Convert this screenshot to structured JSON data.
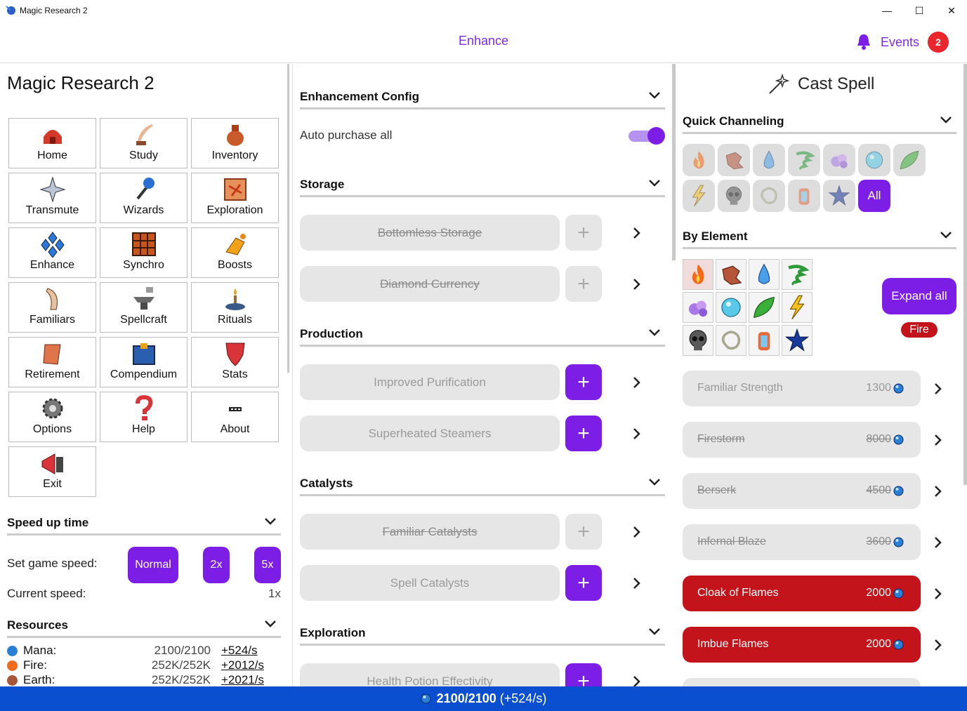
{
  "window": {
    "title": "Magic Research 2",
    "minimize": "—",
    "maximize": "☐",
    "close": "✕"
  },
  "topbar": {
    "page_title": "Enhance",
    "events_label": "Events",
    "events_count": "2"
  },
  "left": {
    "app_title": "Magic Research 2",
    "nav": [
      {
        "label": "Home",
        "icon": "home-icon"
      },
      {
        "label": "Study",
        "icon": "quill-icon"
      },
      {
        "label": "Inventory",
        "icon": "bag-icon"
      },
      {
        "label": "Transmute",
        "icon": "star-icon"
      },
      {
        "label": "Wizards",
        "icon": "wand-icon"
      },
      {
        "label": "Exploration",
        "icon": "map-icon"
      },
      {
        "label": "Enhance",
        "icon": "diamonds-icon"
      },
      {
        "label": "Synchro",
        "icon": "grid-icon"
      },
      {
        "label": "Boosts",
        "icon": "boost-icon"
      },
      {
        "label": "Familiars",
        "icon": "horn-icon"
      },
      {
        "label": "Spellcraft",
        "icon": "anvil-icon"
      },
      {
        "label": "Rituals",
        "icon": "candle-icon"
      },
      {
        "label": "Retirement",
        "icon": "scroll-icon"
      },
      {
        "label": "Compendium",
        "icon": "book-icon"
      },
      {
        "label": "Stats",
        "icon": "shield-icon"
      },
      {
        "label": "Options",
        "icon": "gear-icon"
      },
      {
        "label": "Help",
        "icon": "question-icon"
      },
      {
        "label": "About",
        "icon": "ellipsis-icon"
      },
      {
        "label": "Exit",
        "icon": "exit-icon"
      }
    ],
    "speed": {
      "header": "Speed up time",
      "set_label": "Set game speed:",
      "btn_normal": "Normal",
      "btn_2x": "2x",
      "btn_5x": "5x",
      "current_label": "Current speed:",
      "current_value": "1x"
    },
    "resources": {
      "header": "Resources",
      "items": [
        {
          "name": "Mana:",
          "value": "2100/2100",
          "rate": "+524/s",
          "color": "#2a7fd4"
        },
        {
          "name": "Fire:",
          "value": "252K/252K",
          "rate": "+2012/s",
          "color": "#ef6a1c"
        },
        {
          "name": "Earth:",
          "value": "252K/252K",
          "rate": "+2021/s",
          "color": "#a8573a"
        }
      ]
    }
  },
  "middle": {
    "config": {
      "header": "Enhancement Config",
      "auto_label": "Auto purchase all",
      "auto_on": true
    },
    "sections": [
      {
        "header": "Storage",
        "items": [
          {
            "label": "Bottomless Storage",
            "available": false,
            "purchased": true
          },
          {
            "label": "Diamond Currency",
            "available": false,
            "purchased": true
          }
        ]
      },
      {
        "header": "Production",
        "items": [
          {
            "label": "Improved Purification",
            "available": true,
            "purchased": false
          },
          {
            "label": "Superheated Steamers",
            "available": true,
            "purchased": false
          }
        ]
      },
      {
        "header": "Catalysts",
        "items": [
          {
            "label": "Familiar Catalysts",
            "available": false,
            "purchased": true
          },
          {
            "label": "Spell Catalysts",
            "available": true,
            "purchased": false
          }
        ]
      },
      {
        "header": "Exploration",
        "items": [
          {
            "label": "Health Potion Effectivity",
            "available": true,
            "purchased": false
          }
        ]
      }
    ]
  },
  "right": {
    "cast_title": "Cast Spell",
    "quick": {
      "header": "Quick Channeling",
      "all_label": "All"
    },
    "by_element": {
      "header": "By Element",
      "expand_label": "Expand all",
      "selected": "Fire"
    },
    "spells": [
      {
        "name": "Familiar Strength",
        "cost": "1300",
        "state": "normal"
      },
      {
        "name": "Firestorm",
        "cost": "8000",
        "state": "strike"
      },
      {
        "name": "Berserk",
        "cost": "4500",
        "state": "strike"
      },
      {
        "name": "Infernal Blaze",
        "cost": "3600",
        "state": "strike"
      },
      {
        "name": "Cloak of Flames",
        "cost": "2000",
        "state": "red"
      },
      {
        "name": "Imbue Flames",
        "cost": "2000",
        "state": "red"
      }
    ]
  },
  "footer": {
    "mana": "2100/2100",
    "rate": "(+524/s)"
  },
  "colors": {
    "accent": "#7c1ee6",
    "danger": "#c2141a",
    "footer": "#0a4fcf",
    "mana": "#2a7fd4"
  }
}
